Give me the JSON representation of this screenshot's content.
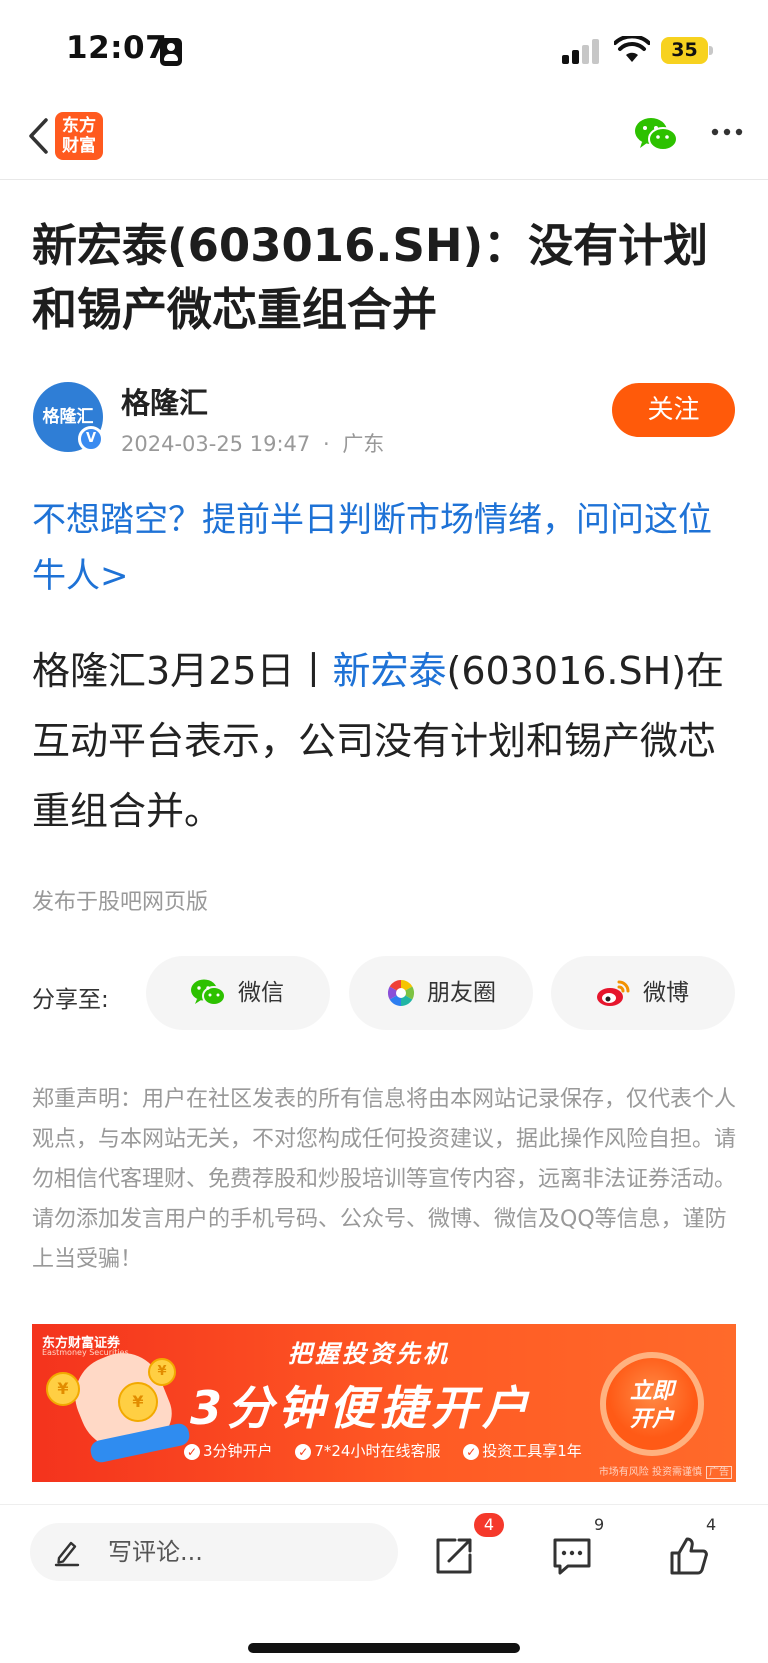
{
  "status_bar": {
    "time": "12:07",
    "battery": "35"
  },
  "nav": {
    "logo_line1": "东方",
    "logo_line2": "财富"
  },
  "article": {
    "title": "新宏泰(603016.SH)：没有计划和锡产微芯重组合并",
    "author": {
      "name": "格隆汇",
      "avatar_text": "格隆汇",
      "verified_mark": "V",
      "date": "2024-03-25 19:47",
      "separator": "·",
      "location": "广东",
      "follow_label": "关注"
    },
    "promo_link": "不想踏空？提前半日判断市场情绪，问问这位牛人>",
    "body": {
      "prefix": "格隆汇3月25日丨",
      "stock_link": "新宏泰",
      "suffix": "(603016.SH)在互动平台表示，公司没有计划和锡产微芯重组合并。"
    },
    "publish_source": "发布于股吧网页版"
  },
  "share": {
    "label": "分享至:",
    "buttons": [
      {
        "label": "微信",
        "icon": "wechat-icon"
      },
      {
        "label": "朋友圈",
        "icon": "moments-icon"
      },
      {
        "label": "微博",
        "icon": "weibo-icon"
      }
    ]
  },
  "disclaimer": "郑重声明：用户在社区发表的所有信息将由本网站记录保存，仅代表个人观点，与本网站无关，不对您构成任何投资建议，据此操作风险自担。请勿相信代客理财、免费荐股和炒股培训等宣传内容，远离非法证券活动。请勿添加发言用户的手机号码、公众号、微博、微信及QQ等信息，谨防上当受骗！",
  "ad": {
    "brand": "东方财富证券",
    "brand_sub": "Eastmoney Securities",
    "headline": "把握投资先机",
    "main": "3分钟便捷开户",
    "features": [
      "3分钟开户",
      "7*24小时在线客服",
      "投资工具享1年"
    ],
    "cta_line1": "立即",
    "cta_line2": "开户",
    "risk": "市场有风险 投资需谨慎",
    "ad_tag": "广告"
  },
  "bottom_bar": {
    "comment_placeholder": "写评论...",
    "share_badge": "4",
    "comment_count": "9",
    "like_count": "4"
  },
  "colors": {
    "accent": "#ff5a0a",
    "link": "#1e72d6",
    "brand_logo": "#ff5a1f"
  }
}
